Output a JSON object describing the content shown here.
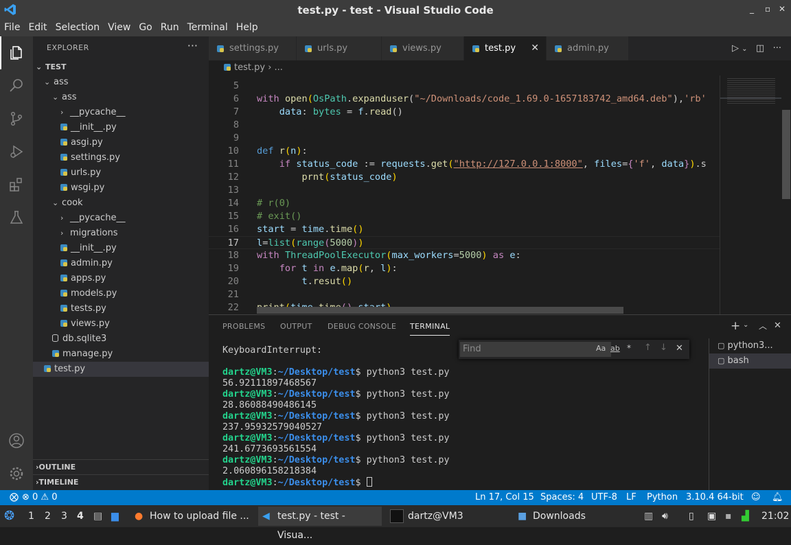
{
  "window": {
    "title": "test.py - test - Visual Studio Code"
  },
  "menu": [
    "File",
    "Edit",
    "Selection",
    "View",
    "Go",
    "Run",
    "Terminal",
    "Help"
  ],
  "explorer": {
    "header": "EXPLORER",
    "more": "···",
    "root": "TEST",
    "items": [
      {
        "label": "ass",
        "kind": "folder-open",
        "indent": 1
      },
      {
        "label": "ass",
        "kind": "folder-open",
        "indent": 2
      },
      {
        "label": "__pycache__",
        "kind": "folder",
        "indent": 3
      },
      {
        "label": "__init__.py",
        "kind": "py",
        "indent": 3
      },
      {
        "label": "asgi.py",
        "kind": "py",
        "indent": 3
      },
      {
        "label": "settings.py",
        "kind": "py",
        "indent": 3
      },
      {
        "label": "urls.py",
        "kind": "py",
        "indent": 3
      },
      {
        "label": "wsgi.py",
        "kind": "py",
        "indent": 3
      },
      {
        "label": "cook",
        "kind": "folder-open",
        "indent": 2
      },
      {
        "label": "__pycache__",
        "kind": "folder",
        "indent": 3
      },
      {
        "label": "migrations",
        "kind": "folder",
        "indent": 3
      },
      {
        "label": "__init__.py",
        "kind": "py",
        "indent": 3
      },
      {
        "label": "admin.py",
        "kind": "py",
        "indent": 3
      },
      {
        "label": "apps.py",
        "kind": "py",
        "indent": 3
      },
      {
        "label": "models.py",
        "kind": "py",
        "indent": 3
      },
      {
        "label": "tests.py",
        "kind": "py",
        "indent": 3
      },
      {
        "label": "views.py",
        "kind": "py",
        "indent": 3
      },
      {
        "label": "db.sqlite3",
        "kind": "db",
        "indent": 2
      },
      {
        "label": "manage.py",
        "kind": "py",
        "indent": 2
      },
      {
        "label": "test.py",
        "kind": "py",
        "indent": 1,
        "selected": true
      }
    ],
    "outline": "OUTLINE",
    "timeline": "TIMELINE"
  },
  "tabs": [
    {
      "label": "settings.py",
      "active": false
    },
    {
      "label": "urls.py",
      "active": false
    },
    {
      "label": "views.py",
      "active": false
    },
    {
      "label": "test.py",
      "active": true
    },
    {
      "label": "admin.py",
      "active": false
    }
  ],
  "breadcrumb": {
    "file": "test.py",
    "sep": "›",
    "rest": "..."
  },
  "code_lines": [
    {
      "n": "5",
      "html": ""
    },
    {
      "n": "6",
      "html": "<span class='kw'>with</span> <span class='fn'>open</span><span class='pn'>(</span><span class='ty'>OsPath</span>.<span class='fn'>expanduser</span>(<span class='st'>\"~/Downloads/code_1.69.0-1657183742_amd64.deb\"</span>),<span class='st'>'rb'</span>"
    },
    {
      "n": "7",
      "html": "    <span class='vr'>data</span>: <span class='ty'>bytes</span> = <span class='vr'>f</span>.<span class='fn'>read</span>()"
    },
    {
      "n": "8",
      "html": ""
    },
    {
      "n": "9",
      "html": ""
    },
    {
      "n": "10",
      "html": "<span class='bl'>def</span> <span class='fn'>r</span><span class='pn'>(</span><span class='vr'>n</span><span class='pn'>)</span>:"
    },
    {
      "n": "11",
      "html": "    <span class='kw'>if</span> <span class='vr'>status_code</span> := <span class='vr'>requests</span>.<span class='fn'>get</span><span class='pn'>(</span><span class='st ul'>\"http://127.0.0.1:8000\"</span>, <span class='vr'>files</span>=<span class='kw'>{</span><span class='st'>'f'</span>, <span class='vr'>data</span><span class='kw'>}</span><span class='pn'>)</span>.s"
    },
    {
      "n": "12",
      "html": "        <span class='fn'>prnt</span><span class='pn'>(</span><span class='vr'>status_code</span><span class='pn'>)</span>"
    },
    {
      "n": "13",
      "html": ""
    },
    {
      "n": "14",
      "html": "<span class='cm'># r(0)</span>"
    },
    {
      "n": "15",
      "html": "<span class='cm'># exit()</span>"
    },
    {
      "n": "16",
      "html": "<span class='vr'>start</span> = <span class='vr'>time</span>.<span class='fn'>time</span><span class='pn'>()</span>"
    },
    {
      "n": "17",
      "html": "<span class='vr'>l</span>=<span class='ty'>list</span><span class='pn'>(</span><span class='ty'>range</span><span class='kw'>(</span><span class='nm'>5000</span><span class='kw'>)</span><span class='pn'>)</span>",
      "current": true
    },
    {
      "n": "18",
      "html": "<span class='kw'>with</span> <span class='ty'>ThreadPoolExecutor</span><span class='pn'>(</span><span class='vr'>max_workers</span>=<span class='nm'>5000</span><span class='pn'>)</span> <span class='kw'>as</span> <span class='vr'>e</span>:"
    },
    {
      "n": "19",
      "html": "    <span class='kw'>for</span> <span class='vr'>t</span> <span class='kw'>in</span> <span class='vr'>e</span>.<span class='fn'>map</span><span class='pn'>(</span><span class='fn'>r</span>, <span class='vr'>l</span><span class='pn'>)</span>:"
    },
    {
      "n": "20",
      "html": "        <span class='vr'>t</span>.<span class='fn'>resut</span><span class='pn'>()</span>"
    },
    {
      "n": "21",
      "html": ""
    },
    {
      "n": "22",
      "html": "<span class='fn'>print</span><span class='pn'>(</span><span class='vr'>time</span>.<span class='fn'>time</span><span class='kw'>()</span>-<span class='vr'>start</span><span class='pn'>)</span>"
    }
  ],
  "panel": {
    "tabs": [
      "PROBLEMS",
      "OUTPUT",
      "DEBUG CONSOLE",
      "TERMINAL"
    ],
    "active_tab": "TERMINAL",
    "find_placeholder": "Find",
    "find_opts": [
      "Aa",
      "ab",
      "*"
    ],
    "terminal_lines": [
      {
        "type": "text",
        "text": "KeyboardInterrupt:"
      },
      {
        "type": "text",
        "text": ""
      },
      {
        "type": "prompt",
        "user": "dartz@VM3",
        "path": "~/Desktop/test",
        "cmd": " python3 test.py"
      },
      {
        "type": "text",
        "text": "56.92111897468567"
      },
      {
        "type": "prompt",
        "user": "dartz@VM3",
        "path": "~/Desktop/test",
        "cmd": " python3 test.py"
      },
      {
        "type": "text",
        "text": "28.86088490486145"
      },
      {
        "type": "prompt",
        "user": "dartz@VM3",
        "path": "~/Desktop/test",
        "cmd": " python3 test.py"
      },
      {
        "type": "text",
        "text": "237.95932579040527"
      },
      {
        "type": "prompt",
        "user": "dartz@VM3",
        "path": "~/Desktop/test",
        "cmd": " python3 test.py"
      },
      {
        "type": "text",
        "text": "241.6773693561554"
      },
      {
        "type": "prompt",
        "user": "dartz@VM3",
        "path": "~/Desktop/test",
        "cmd": " python3 test.py"
      },
      {
        "type": "text",
        "text": "2.060896158218384"
      },
      {
        "type": "prompt",
        "user": "dartz@VM3",
        "path": "~/Desktop/test",
        "cmd": " "
      }
    ],
    "terminals": [
      {
        "label": "python3...",
        "selected": false
      },
      {
        "label": "bash",
        "selected": true
      }
    ]
  },
  "status": {
    "problems": "⊗ 0 ⚠ 0",
    "position": "Ln 17, Col 15",
    "spaces": "Spaces: 4",
    "encoding": "UTF-8",
    "eol": "LF",
    "language": "Python",
    "interpreter": "3.10.4 64-bit"
  },
  "taskbar": {
    "workspaces": [
      "1",
      "2",
      "3",
      "4"
    ],
    "windows": [
      {
        "label": "How to upload file ...",
        "active": false
      },
      {
        "label": "test.py - test - Visua...",
        "active": true
      },
      {
        "label": "dartz@VM3",
        "active": false
      },
      {
        "label": "Downloads",
        "active": false
      }
    ],
    "clock": "21:02"
  }
}
